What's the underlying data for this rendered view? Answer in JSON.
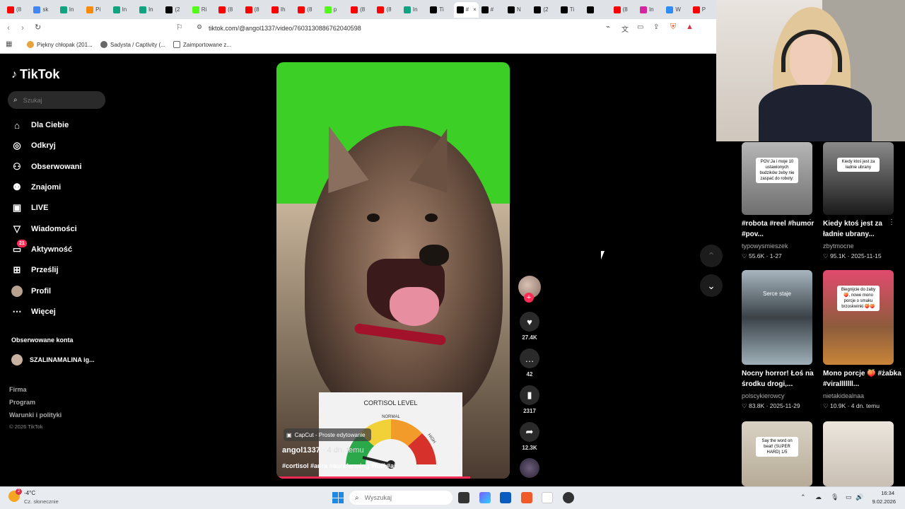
{
  "browser": {
    "tabs": [
      {
        "icon": "youtube-icon",
        "label": "(8",
        "color": "#ff0000"
      },
      {
        "icon": "google-icon",
        "label": "sk",
        "color": "#4285f4"
      },
      {
        "icon": "chatgpt-icon",
        "label": "In",
        "color": "#10a37f"
      },
      {
        "icon": "reddit-icon",
        "label": "Pi",
        "color": "#ff8a00"
      },
      {
        "icon": "chatgpt-icon",
        "label": "In",
        "color": "#10a37f"
      },
      {
        "icon": "chatgpt-icon",
        "label": "In",
        "color": "#10a37f"
      },
      {
        "icon": "x-icon",
        "label": "(2",
        "color": "#000000"
      },
      {
        "icon": "kick-icon",
        "label": "Ri",
        "color": "#53fc18"
      },
      {
        "icon": "youtube-icon",
        "label": "(8",
        "color": "#ff0000"
      },
      {
        "icon": "youtube-icon",
        "label": "(8",
        "color": "#ff0000"
      },
      {
        "icon": "youtube-icon",
        "label": "Ih",
        "color": "#ff0000"
      },
      {
        "icon": "youtube-icon",
        "label": "(8",
        "color": "#ff0000"
      },
      {
        "icon": "kick-icon",
        "label": "p",
        "color": "#53fc18"
      },
      {
        "icon": "youtube-icon",
        "label": "(8",
        "color": "#ff0000"
      },
      {
        "icon": "youtube-icon",
        "label": "(8",
        "color": "#ff0000"
      },
      {
        "icon": "chatgpt-icon",
        "label": "In",
        "color": "#10a37f"
      },
      {
        "icon": "tiktok-icon",
        "label": "Ti",
        "color": "#000000"
      },
      {
        "icon": "tiktok-icon",
        "label": "#",
        "color": "#000000",
        "active": true
      },
      {
        "icon": "tiktok-icon",
        "label": "#",
        "color": "#000000"
      },
      {
        "icon": "tiktok-icon",
        "label": "N",
        "color": "#000000"
      },
      {
        "icon": "x-icon",
        "label": "(2",
        "color": "#000000"
      },
      {
        "icon": "tiktok-icon",
        "label": "Ti",
        "color": "#000000"
      },
      {
        "icon": "x-icon",
        "label": "",
        "color": "#000000"
      },
      {
        "icon": "youtube-icon",
        "label": "(8",
        "color": "#ff0000"
      },
      {
        "icon": "instagram-icon",
        "label": "In",
        "color": "#d6249f"
      },
      {
        "icon": "web-icon",
        "label": "W",
        "color": "#2b8cf6"
      },
      {
        "icon": "youtube-icon",
        "label": "P",
        "color": "#ff0000"
      }
    ],
    "url": "tiktok.com/@angol1337/video/7603130886762040598",
    "bookmarks": [
      {
        "icon": "bookmark-favicon-icon",
        "label": "Piękny chłopak (201..."
      },
      {
        "icon": "globe-icon",
        "label": "Sadysta / Captivity (..."
      },
      {
        "icon": "folder-icon",
        "label": "Zaimportowane z..."
      }
    ]
  },
  "sidebar": {
    "logo": "TikTok",
    "search_placeholder": "Szukaj",
    "nav": [
      {
        "icon": "home-icon",
        "label": "Dla Ciebie"
      },
      {
        "icon": "compass-icon",
        "label": "Odkryj"
      },
      {
        "icon": "following-icon",
        "label": "Obserwowani"
      },
      {
        "icon": "friends-icon",
        "label": "Znajomi"
      },
      {
        "icon": "live-icon",
        "label": "LIVE"
      },
      {
        "icon": "messages-icon",
        "label": "Wiadomości"
      },
      {
        "icon": "activity-icon",
        "label": "Aktywność",
        "badge": "21"
      },
      {
        "icon": "upload-icon",
        "label": "Prześlij"
      },
      {
        "icon": "profile-avatar-icon",
        "label": "Profil"
      },
      {
        "icon": "more-icon",
        "label": "Więcej"
      }
    ],
    "followed_title": "Obserwowane konta",
    "followed": [
      {
        "name": "SZALINAMALINA ig..."
      }
    ],
    "footer": [
      "Firma",
      "Program",
      "Warunki i polityki"
    ],
    "copyright": "© 2026 TikTok"
  },
  "video": {
    "gauge_title": "CORTISOL LEVEL",
    "gauge_labels": [
      "NORMAL",
      "HIGH"
    ],
    "capcut_label": "CapCut - Proste edytowanie",
    "author": "angol1337",
    "time": " · 4 dn. temu",
    "tags": "#cortisol #aura #aurafarming #tuff #ai",
    "progress": 0.83
  },
  "actions": {
    "likes": "27.4K",
    "comments": "42",
    "saves": "2317",
    "shares": "12.3K"
  },
  "feed": [
    {
      "caption": "#robota #reel #humor #pov...",
      "user": "typowysmieszek",
      "likes": "55.6K",
      "date": "1-27",
      "overlay": "POV:Ja i moje 10 ustawionych budzików żeby nie zaspać do roboty:"
    },
    {
      "caption": "Kiedy ktoś jest za ładnie ubrany...",
      "user": "zbytmocne",
      "likes": "95.1K",
      "date": "2025-11-15",
      "overlay": "Kiedy ktoś jest za ładnie ubrany"
    },
    {
      "caption": "Nocny horror! Łoś na środku drogi,...",
      "user": "polscykierowcy",
      "likes": "83.8K",
      "date": "2025-11-29",
      "overlay": "Serce staje"
    },
    {
      "caption": "Mono porcje 🍑 #żabka #viralllllll...",
      "user": "nietakidealnaa",
      "likes": "10.9K",
      "date": "4 dn. temu",
      "overlay": "Biegnijcie do żaby 🍑, nowe mono porcje o smaku brzoskwinki 🍑🍑"
    },
    {
      "caption": "",
      "user": "",
      "likes": "",
      "date": "",
      "overlay": "Say the word on beat! (SUPER HARD) 1/5"
    },
    {
      "caption": "",
      "user": "",
      "likes": "",
      "date": "",
      "overlay": ""
    }
  ],
  "taskbar": {
    "weather_temp": "-4°C",
    "weather_desc": "Cz. słonecznie",
    "weather_badge": "2",
    "search_placeholder": "Wyszukaj",
    "time": "16:34",
    "date": "9.02.2026"
  }
}
